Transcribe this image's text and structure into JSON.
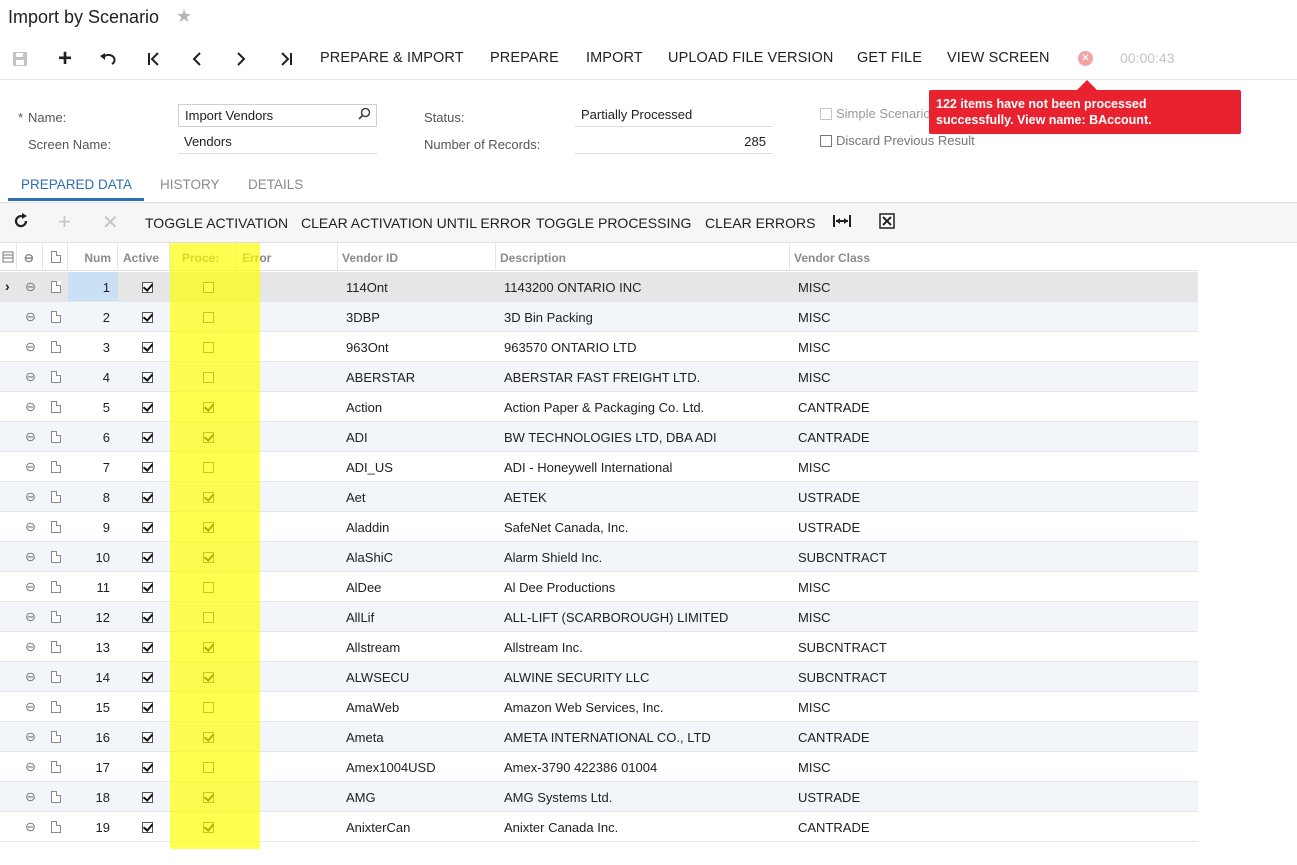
{
  "page": {
    "title": "Import by Scenario"
  },
  "toolbar": {
    "prepare_import": "PREPARE & IMPORT",
    "prepare": "PREPARE",
    "import": "IMPORT",
    "upload_file_version": "UPLOAD FILE VERSION",
    "get_file": "GET FILE",
    "view_screen": "VIEW SCREEN",
    "timer": "00:00:43"
  },
  "form": {
    "required_mark": "*",
    "name_label": "Name:",
    "name_value": "Import Vendors",
    "screen_name_label": "Screen Name:",
    "screen_name_value": "Vendors",
    "status_label": "Status:",
    "status_value": "Partially Processed",
    "records_label": "Number of Records:",
    "records_value": "285",
    "simple_scenario_label": "Simple Scenario",
    "discard_label": "Discard Previous Result"
  },
  "tooltip": {
    "line1": "122 items have not been processed",
    "line2": "successfully. View name: BAccount."
  },
  "tabs": {
    "prepared": "PREPARED DATA",
    "history": "HISTORY",
    "details": "DETAILS"
  },
  "grid_toolbar": {
    "toggle_activation": "TOGGLE ACTIVATION",
    "clear_activation": "CLEAR ACTIVATION UNTIL ERROR",
    "toggle_processing": "TOGGLE PROCESSING",
    "clear_errors": "CLEAR ERRORS"
  },
  "grid": {
    "columns": {
      "num": "Num",
      "active": "Active",
      "processed": "Proce:",
      "error": "Error",
      "vendor_id": "Vendor ID",
      "description": "Description",
      "vendor_class": "Vendor Class"
    },
    "rows": [
      {
        "num": "1",
        "active": true,
        "processed": false,
        "vendor_id": "114Ont",
        "description": "1143200 ONTARIO INC",
        "vendor_class": "MISC"
      },
      {
        "num": "2",
        "active": true,
        "processed": false,
        "vendor_id": "3DBP",
        "description": "3D Bin Packing",
        "vendor_class": "MISC"
      },
      {
        "num": "3",
        "active": true,
        "processed": false,
        "vendor_id": "963Ont",
        "description": "963570 ONTARIO LTD",
        "vendor_class": "MISC"
      },
      {
        "num": "4",
        "active": true,
        "processed": false,
        "vendor_id": "ABERSTAR",
        "description": "ABERSTAR FAST FREIGHT LTD.",
        "vendor_class": "MISC"
      },
      {
        "num": "5",
        "active": true,
        "processed": true,
        "vendor_id": "Action",
        "description": "Action Paper & Packaging Co. Ltd.",
        "vendor_class": "CANTRADE"
      },
      {
        "num": "6",
        "active": true,
        "processed": true,
        "vendor_id": "ADI",
        "description": "BW TECHNOLOGIES LTD, DBA ADI",
        "vendor_class": "CANTRADE"
      },
      {
        "num": "7",
        "active": true,
        "processed": false,
        "vendor_id": "ADI_US",
        "description": "ADI - Honeywell International",
        "vendor_class": "MISC"
      },
      {
        "num": "8",
        "active": true,
        "processed": true,
        "vendor_id": "Aet",
        "description": "AETEK",
        "vendor_class": "USTRADE"
      },
      {
        "num": "9",
        "active": true,
        "processed": true,
        "vendor_id": "Aladdin",
        "description": "SafeNet Canada, Inc.",
        "vendor_class": "USTRADE"
      },
      {
        "num": "10",
        "active": true,
        "processed": true,
        "vendor_id": "AlaShiC",
        "description": "Alarm Shield Inc.",
        "vendor_class": "SUBCNTRACT"
      },
      {
        "num": "11",
        "active": true,
        "processed": false,
        "vendor_id": "AlDee",
        "description": "Al Dee Productions",
        "vendor_class": "MISC"
      },
      {
        "num": "12",
        "active": true,
        "processed": false,
        "vendor_id": "AllLif",
        "description": "ALL-LIFT (SCARBOROUGH) LIMITED",
        "vendor_class": "MISC"
      },
      {
        "num": "13",
        "active": true,
        "processed": true,
        "vendor_id": "Allstream",
        "description": "Allstream Inc.",
        "vendor_class": "SUBCNTRACT"
      },
      {
        "num": "14",
        "active": true,
        "processed": true,
        "vendor_id": "ALWSECU",
        "description": "ALWINE SECURITY LLC",
        "vendor_class": "SUBCNTRACT"
      },
      {
        "num": "15",
        "active": true,
        "processed": false,
        "vendor_id": "AmaWeb",
        "description": "Amazon Web Services, Inc.",
        "vendor_class": "MISC"
      },
      {
        "num": "16",
        "active": true,
        "processed": true,
        "vendor_id": "Ameta",
        "description": "AMETA INTERNATIONAL CO., LTD",
        "vendor_class": "CANTRADE"
      },
      {
        "num": "17",
        "active": true,
        "processed": false,
        "vendor_id": "Amex1004USD",
        "description": "Amex-3790 422386 01004",
        "vendor_class": "MISC"
      },
      {
        "num": "18",
        "active": true,
        "processed": true,
        "vendor_id": "AMG",
        "description": "AMG Systems Ltd.",
        "vendor_class": "USTRADE"
      },
      {
        "num": "19",
        "active": true,
        "processed": true,
        "vendor_id": "AnixterCan",
        "description": "Anixter Canada Inc.",
        "vendor_class": "CANTRADE"
      }
    ]
  }
}
